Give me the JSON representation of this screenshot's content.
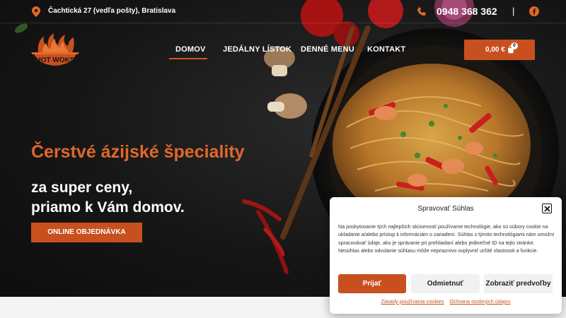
{
  "topbar": {
    "address": "Čachtická 27 (vedľa pošty), Bratislava",
    "phone": "0948 368 362",
    "separator": "|",
    "icons": {
      "address": "map-pin-icon",
      "phone": "phone-icon",
      "social": "facebook-icon"
    }
  },
  "logo": {
    "text": "HOT WOKS"
  },
  "nav": {
    "items": [
      {
        "label": "DOMOV",
        "active": true
      },
      {
        "label": "JEDÁLNY LÍSTOK",
        "active": false
      },
      {
        "label": "DENNÉ MENU",
        "active": false
      },
      {
        "label": "KONTAKT",
        "active": false
      }
    ]
  },
  "cart": {
    "total": "0,00 €",
    "count": "0",
    "icon": "shopping-bag-icon"
  },
  "hero": {
    "title": "Čerstvé ázijské špeciality",
    "subtitle_line1": "za super ceny,",
    "subtitle_line2": "priamo k Vám domov.",
    "cta_label": "ONLINE OBJEDNÁVKA"
  },
  "consent": {
    "title": "Spravovať Súhlas",
    "body": "Na poskytovanie tých najlepších skúseností používame technológie, ako sú súbory cookie na ukladanie a/alebo prístup k informáciám o zariadení. Súhlas s týmito technológiami nám umožní spracovávať údaje, ako je správanie pri prehliadaní alebo jedinečné ID na tejto stránke. Nesúhlas alebo odvolanie súhlasu môže nepriaznivo ovplyvniť určité vlastnosti a funkcie.",
    "accept_label": "Prijať",
    "deny_label": "Odmietnuť",
    "prefs_label": "Zobraziť predvoľby",
    "link_cookies": "Zásady používania cookies",
    "link_privacy": "Ochrana osobných údajov"
  },
  "colors": {
    "accent": "#c8501f",
    "accent_text": "#e0682a",
    "background": "#161616"
  }
}
